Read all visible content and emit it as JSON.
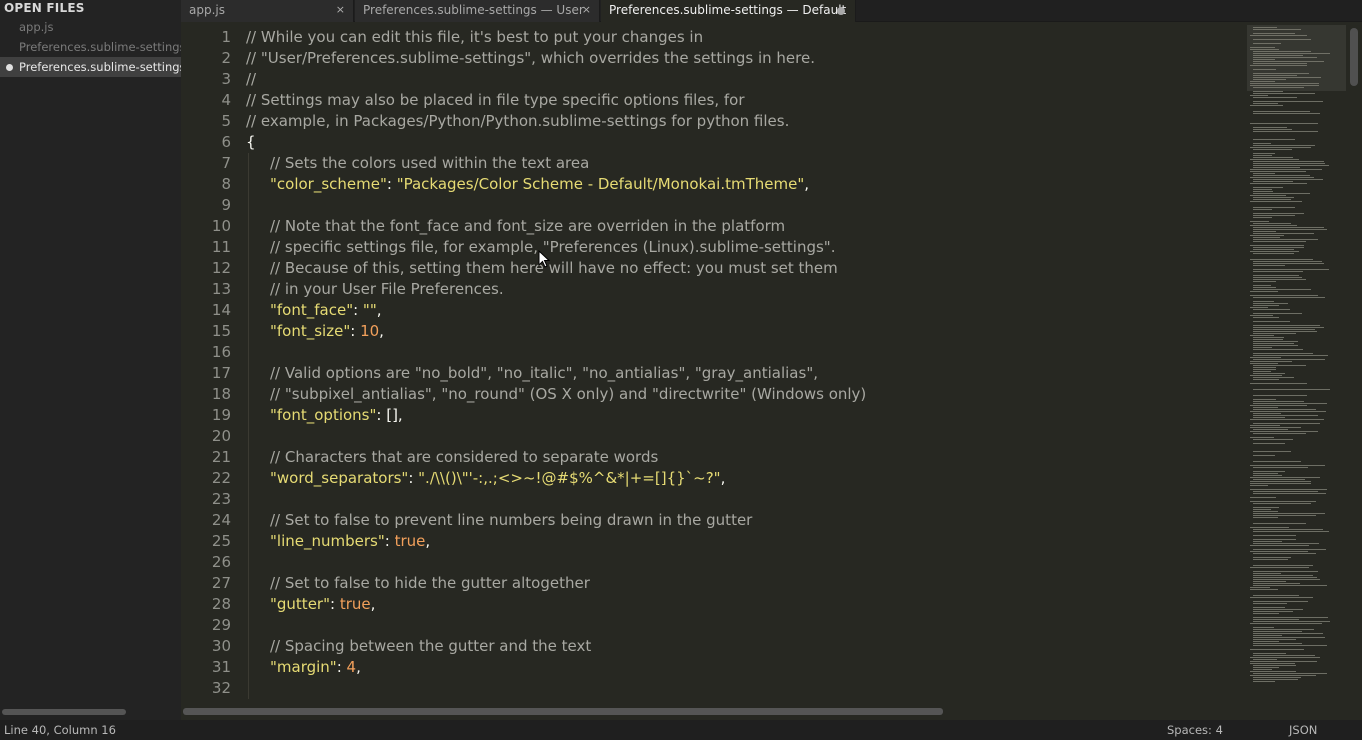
{
  "sidebar": {
    "header": "OPEN FILES",
    "items": [
      {
        "label": "app.js",
        "active": false
      },
      {
        "label": "Preferences.sublime-settings",
        "active": false
      },
      {
        "label": "Preferences.sublime-settings",
        "active": true
      }
    ]
  },
  "tabs": [
    {
      "label": "app.js",
      "close": "×",
      "active": false
    },
    {
      "label": "Preferences.sublime-settings — User",
      "close": "×",
      "active": false
    },
    {
      "label": "Preferences.sublime-settings — Default",
      "active": true,
      "dirty": true
    }
  ],
  "editor": {
    "line_numbers": [
      "1",
      "2",
      "3",
      "4",
      "5",
      "6",
      "7",
      "8",
      "9",
      "10",
      "11",
      "12",
      "13",
      "14",
      "15",
      "16",
      "17",
      "18",
      "19",
      "20",
      "21",
      "22",
      "23",
      "24",
      "25",
      "26",
      "27",
      "28",
      "29",
      "30",
      "31",
      "32"
    ],
    "lines": [
      {
        "indent": 0,
        "segments": [
          {
            "t": "// While you can edit this file, it's best to put your changes in",
            "c": "comment"
          }
        ]
      },
      {
        "indent": 0,
        "segments": [
          {
            "t": "// \"User/Preferences.sublime-settings\", which overrides the settings in here.",
            "c": "comment"
          }
        ]
      },
      {
        "indent": 0,
        "segments": [
          {
            "t": "//",
            "c": "comment"
          }
        ]
      },
      {
        "indent": 0,
        "segments": [
          {
            "t": "// Settings may also be placed in file type specific options files, for",
            "c": "comment"
          }
        ]
      },
      {
        "indent": 0,
        "segments": [
          {
            "t": "// example, in Packages/Python/Python.sublime-settings for python files.",
            "c": "comment"
          }
        ]
      },
      {
        "indent": 0,
        "segments": [
          {
            "t": "{",
            "c": "plain"
          }
        ]
      },
      {
        "indent": 1,
        "segments": [
          {
            "t": "// Sets the colors used within the text area",
            "c": "comment"
          }
        ]
      },
      {
        "indent": 1,
        "segments": [
          {
            "t": "\"color_scheme\"",
            "c": "key"
          },
          {
            "t": ": ",
            "c": "plain"
          },
          {
            "t": "\"Packages/Color Scheme - Default/Monokai.tmTheme\"",
            "c": "str"
          },
          {
            "t": ",",
            "c": "plain"
          }
        ]
      },
      {
        "indent": 0,
        "segments": []
      },
      {
        "indent": 1,
        "segments": [
          {
            "t": "// Note that the font_face and font_size are overriden in the platform",
            "c": "comment"
          }
        ]
      },
      {
        "indent": 1,
        "segments": [
          {
            "t": "// specific settings file, for example, \"Preferences (Linux).sublime-settings\".",
            "c": "comment"
          }
        ]
      },
      {
        "indent": 1,
        "segments": [
          {
            "t": "// Because of this, setting them here will have no effect: you must set them",
            "c": "comment"
          }
        ]
      },
      {
        "indent": 1,
        "segments": [
          {
            "t": "// in your User File Preferences.",
            "c": "comment"
          }
        ]
      },
      {
        "indent": 1,
        "segments": [
          {
            "t": "\"font_face\"",
            "c": "key"
          },
          {
            "t": ": ",
            "c": "plain"
          },
          {
            "t": "\"\"",
            "c": "str"
          },
          {
            "t": ",",
            "c": "plain"
          }
        ]
      },
      {
        "indent": 1,
        "segments": [
          {
            "t": "\"font_size\"",
            "c": "key"
          },
          {
            "t": ": ",
            "c": "plain"
          },
          {
            "t": "10",
            "c": "num"
          },
          {
            "t": ",",
            "c": "plain"
          }
        ]
      },
      {
        "indent": 0,
        "segments": []
      },
      {
        "indent": 1,
        "segments": [
          {
            "t": "// Valid options are \"no_bold\", \"no_italic\", \"no_antialias\", \"gray_antialias\",",
            "c": "comment"
          }
        ]
      },
      {
        "indent": 1,
        "segments": [
          {
            "t": "// \"subpixel_antialias\", \"no_round\" (OS X only) and \"directwrite\" (Windows only)",
            "c": "comment"
          }
        ]
      },
      {
        "indent": 1,
        "segments": [
          {
            "t": "\"font_options\"",
            "c": "key"
          },
          {
            "t": ": [],",
            "c": "plain"
          }
        ]
      },
      {
        "indent": 0,
        "segments": []
      },
      {
        "indent": 1,
        "segments": [
          {
            "t": "// Characters that are considered to separate words",
            "c": "comment"
          }
        ]
      },
      {
        "indent": 1,
        "segments": [
          {
            "t": "\"word_separators\"",
            "c": "key"
          },
          {
            "t": ": ",
            "c": "plain"
          },
          {
            "t": "\"./\\\\()\\\"'-:,.;<>~!@#$%^&*|+=[]{}`~?\"",
            "c": "str"
          },
          {
            "t": ",",
            "c": "plain"
          }
        ]
      },
      {
        "indent": 0,
        "segments": []
      },
      {
        "indent": 1,
        "segments": [
          {
            "t": "// Set to false to prevent line numbers being drawn in the gutter",
            "c": "comment"
          }
        ]
      },
      {
        "indent": 1,
        "segments": [
          {
            "t": "\"line_numbers\"",
            "c": "key"
          },
          {
            "t": ": ",
            "c": "plain"
          },
          {
            "t": "true",
            "c": "bool"
          },
          {
            "t": ",",
            "c": "plain"
          }
        ]
      },
      {
        "indent": 0,
        "segments": []
      },
      {
        "indent": 1,
        "segments": [
          {
            "t": "// Set to false to hide the gutter altogether",
            "c": "comment"
          }
        ]
      },
      {
        "indent": 1,
        "segments": [
          {
            "t": "\"gutter\"",
            "c": "key"
          },
          {
            "t": ": ",
            "c": "plain"
          },
          {
            "t": "true",
            "c": "bool"
          },
          {
            "t": ",",
            "c": "plain"
          }
        ]
      },
      {
        "indent": 0,
        "segments": []
      },
      {
        "indent": 1,
        "segments": [
          {
            "t": "// Spacing between the gutter and the text",
            "c": "comment"
          }
        ]
      },
      {
        "indent": 1,
        "segments": [
          {
            "t": "\"margin\"",
            "c": "key"
          },
          {
            "t": ": ",
            "c": "plain"
          },
          {
            "t": "4",
            "c": "num"
          },
          {
            "t": ",",
            "c": "plain"
          }
        ]
      },
      {
        "indent": 0,
        "segments": []
      }
    ]
  },
  "statusbar": {
    "position": "Line 40, Column 16",
    "indentation": "Spaces: 4",
    "syntax": "JSON"
  },
  "theme": {
    "background": "#272822",
    "comment": "#a8a8a2",
    "string": "#e6db74",
    "number": "#f2a05b",
    "foreground": "#f8f8f2"
  }
}
